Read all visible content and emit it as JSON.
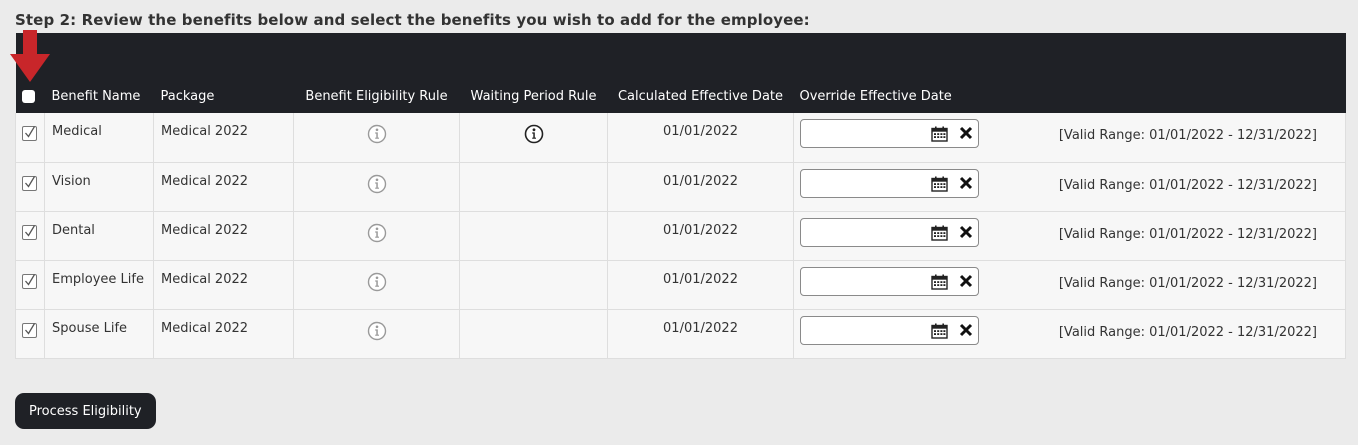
{
  "step_title": "Step 2: Review the benefits below and select the benefits you wish to add for the employee:",
  "columns": {
    "benefit_name": "Benefit Name",
    "package": "Package",
    "eligibility_rule": "Benefit Eligibility Rule",
    "waiting_period_rule": "Waiting Period Rule",
    "calculated_date": "Calculated Effective Date",
    "override_date": "Override Effective Date"
  },
  "rows": [
    {
      "checked": true,
      "name": "Medical",
      "package": "Medical 2022",
      "waiting_icon": "info-icon-dark",
      "calculated": "01/01/2022",
      "override_value": "",
      "range": "[Valid Range: 01/01/2022 - 12/31/2022]"
    },
    {
      "checked": true,
      "name": "Vision",
      "package": "Medical 2022",
      "waiting_icon": "",
      "calculated": "01/01/2022",
      "override_value": "",
      "range": "[Valid Range: 01/01/2022 - 12/31/2022]"
    },
    {
      "checked": true,
      "name": "Dental",
      "package": "Medical 2022",
      "waiting_icon": "",
      "calculated": "01/01/2022",
      "override_value": "",
      "range": "[Valid Range: 01/01/2022 - 12/31/2022]"
    },
    {
      "checked": true,
      "name": "Employee Life",
      "package": "Medical 2022",
      "waiting_icon": "",
      "calculated": "01/01/2022",
      "override_value": "",
      "range": "[Valid Range: 01/01/2022 - 12/31/2022]"
    },
    {
      "checked": true,
      "name": "Spouse Life",
      "package": "Medical 2022",
      "waiting_icon": "",
      "calculated": "01/01/2022",
      "override_value": "",
      "range": "[Valid Range: 01/01/2022 - 12/31/2022]"
    }
  ],
  "process_button": "Process Eligibility",
  "colors": {
    "header_bg": "#1f2126",
    "page_bg": "#ebebeb",
    "arrow": "#c8262a"
  }
}
